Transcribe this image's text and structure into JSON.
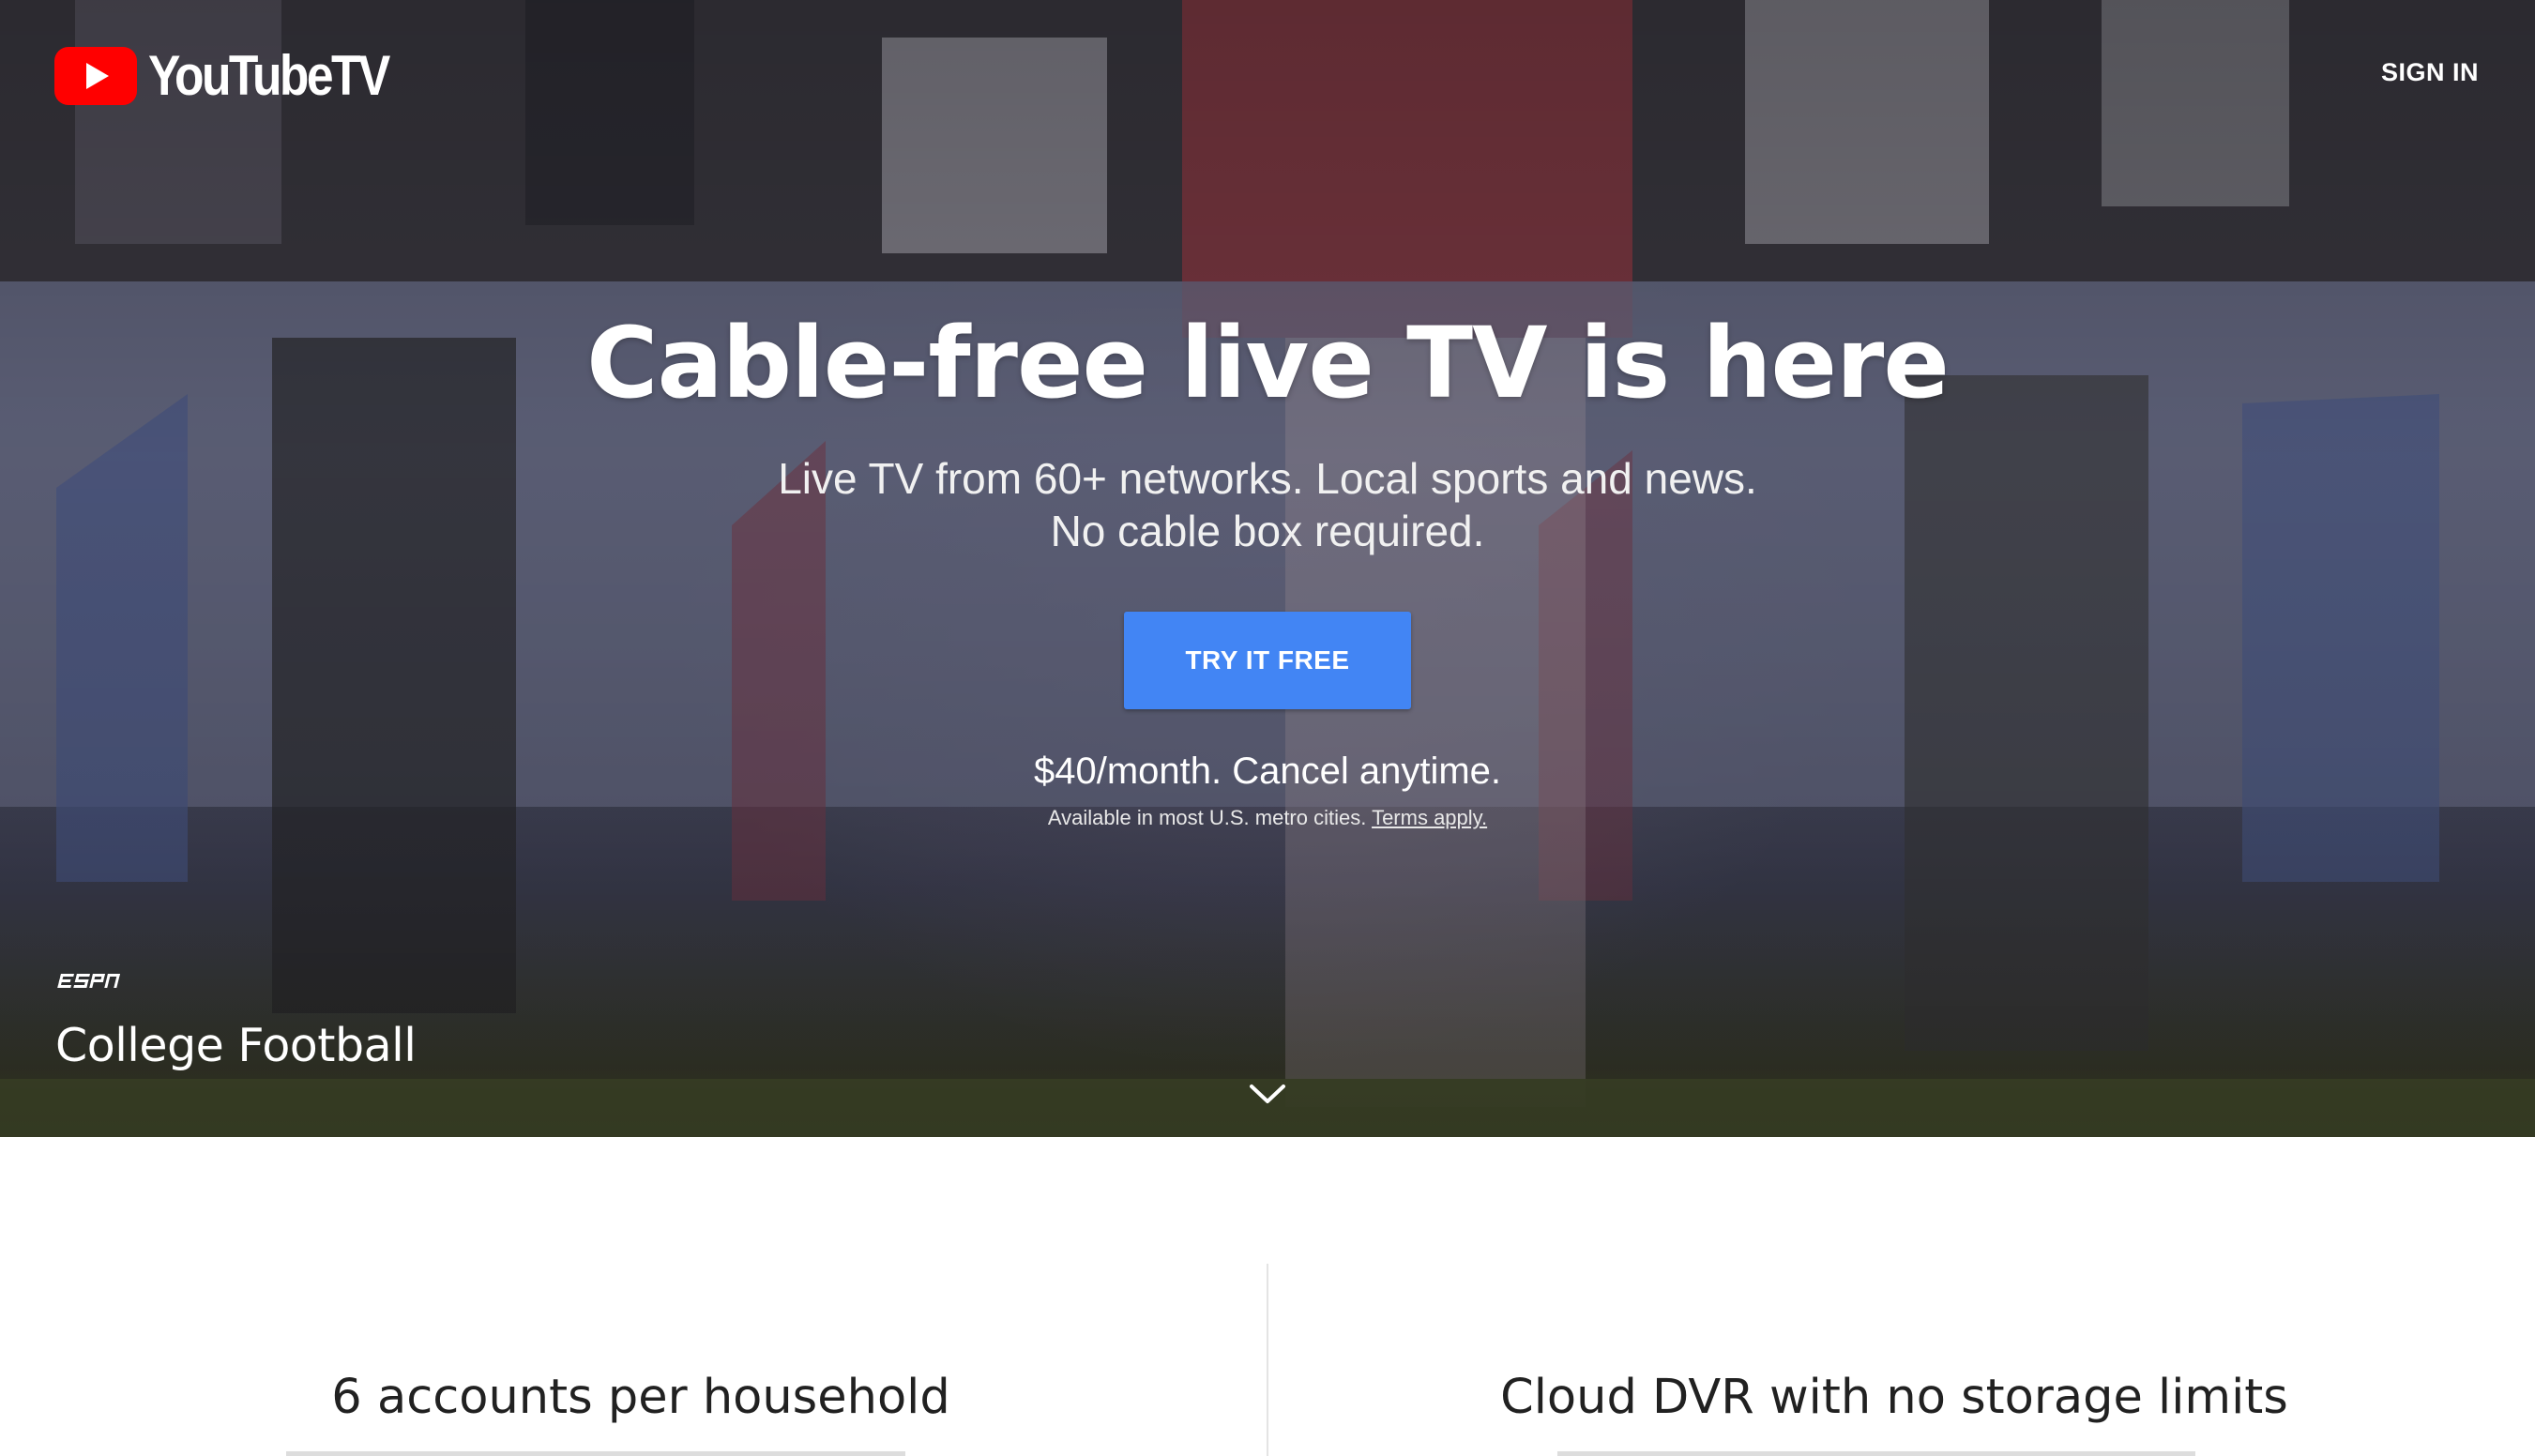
{
  "brand": {
    "logo_text": "YouTubeTV",
    "logo_red": "#ff0000"
  },
  "header": {
    "sign_in_label": "SIGN IN"
  },
  "hero": {
    "headline": "Cable-free live TV is here",
    "subheadline_line1": "Live TV from 60+ networks. Local sports and news.",
    "subheadline_line2": "No cable box required.",
    "cta_label": "TRY IT FREE",
    "cta_color": "#4285f4",
    "price_text": "$40/month. Cancel anytime.",
    "availability_text": "Available in most U.S. metro cities.",
    "terms_link": "Terms apply.",
    "channel_logo": "espn-logo",
    "program_title": "College Football",
    "scroll_icon": "chevron-down-icon"
  },
  "features": [
    {
      "title": "6 accounts per household"
    },
    {
      "title": "Cloud DVR with no storage limits"
    }
  ]
}
